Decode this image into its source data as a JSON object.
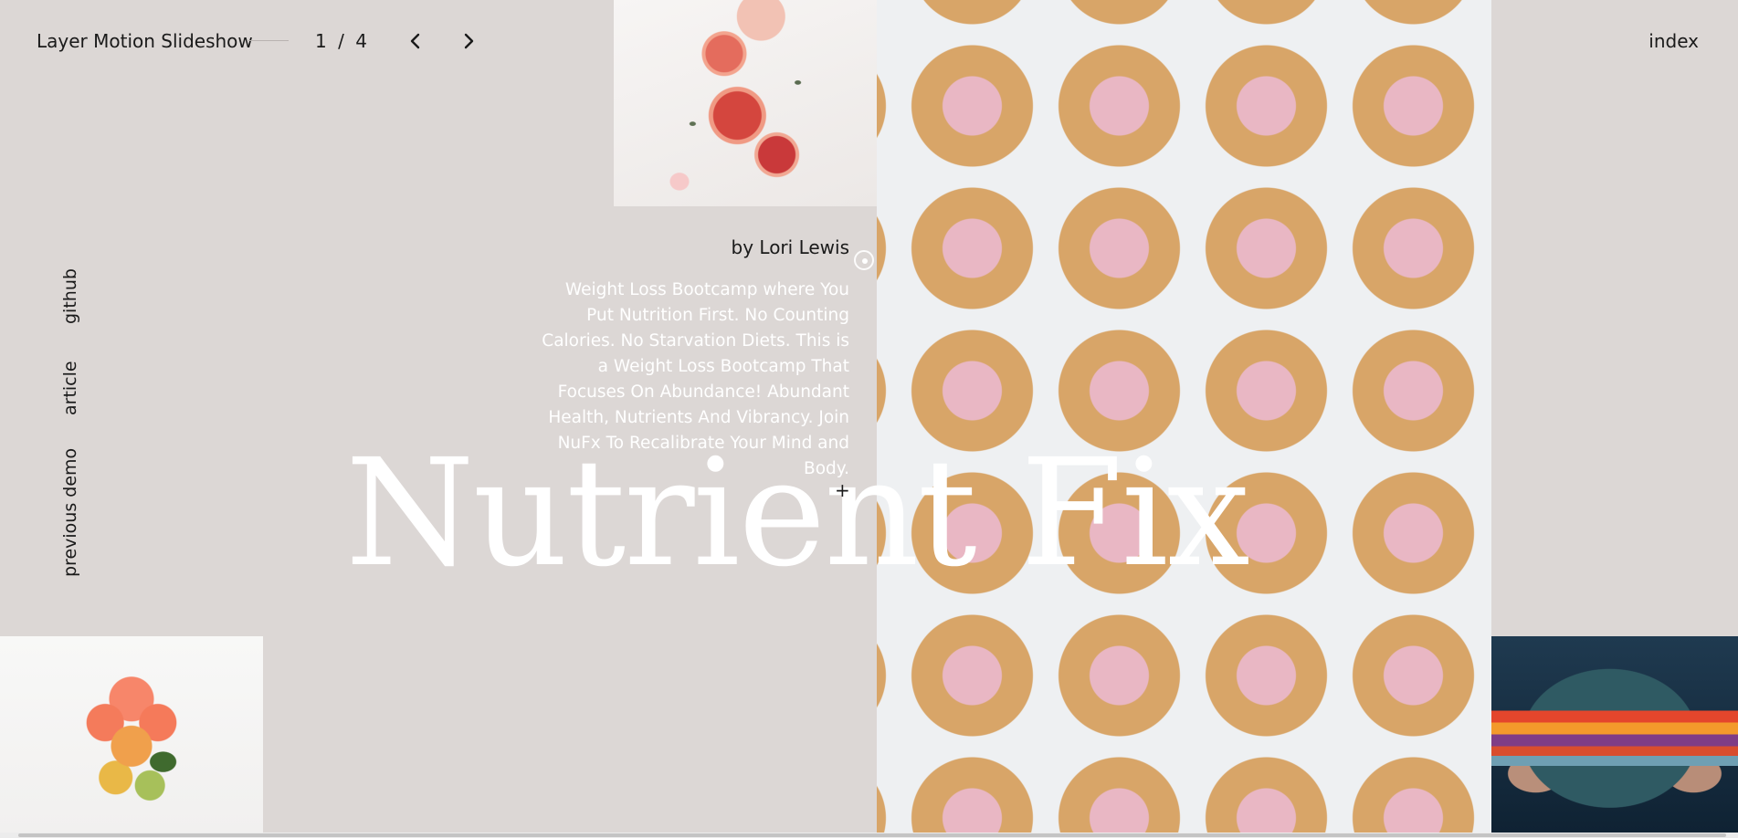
{
  "header": {
    "site_title": "Layer Motion Slideshow",
    "pager": {
      "current": "1",
      "separator": "/",
      "total": "4"
    },
    "prev_icon": "chevron-left-icon",
    "next_icon": "chevron-right-icon",
    "index_label": "index"
  },
  "side_links": {
    "github": "github",
    "article": "article",
    "previous_demo": "previous demo"
  },
  "slide": {
    "byline": "by Lori Lewis",
    "description": "Weight Loss Bootcamp where You Put Nutrition First. No Counting Calories. No Starvation Diets. This is a Weight Loss Bootcamp That Focuses On Abundance! Abundant Health, Nutrients And Vibrancy. Join NuFx To Recalibrate Your Mind and Body.",
    "title": "Nutrient Fix",
    "more_symbol": "+"
  },
  "colors": {
    "background": "#dcd7d5",
    "text": "#1a1a1a",
    "headline": "#ffffff"
  }
}
